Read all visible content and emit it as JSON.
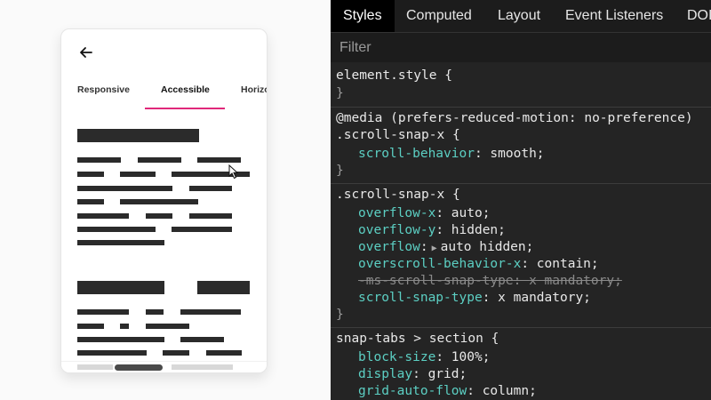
{
  "phone": {
    "tabs": [
      "Responsive",
      "Accessible",
      "Horizo"
    ],
    "active_tab": "Accessible",
    "accent_color": "#e0287a",
    "back_icon": "arrow-left-icon"
  },
  "devtools": {
    "tabs": [
      "Styles",
      "Computed",
      "Layout",
      "Event Listeners",
      "DOI"
    ],
    "active_tab": "Styles",
    "filter_placeholder": "Filter",
    "rules": {
      "element_style": {
        "selector": "element.style {",
        "close": "}"
      },
      "media_rule": {
        "media": "@media (prefers-reduced-motion: no-preference)",
        "selector": ".scroll-snap-x {",
        "decls": [
          {
            "prop": "scroll-behavior",
            "value": "smooth;"
          }
        ],
        "close": "}"
      },
      "snap_rule": {
        "selector": ".scroll-snap-x {",
        "decls": [
          {
            "prop": "overflow-x",
            "value": "auto;"
          },
          {
            "prop": "overflow-y",
            "value": "hidden;"
          },
          {
            "prop": "overflow",
            "value": "auto hidden;"
          },
          {
            "prop": "overscroll-behavior-x",
            "value": "contain;"
          },
          {
            "prop": "-ms-scroll-snap-type",
            "value": "x mandatory;"
          },
          {
            "prop": "scroll-snap-type",
            "value": "x mandatory;"
          }
        ],
        "close": "}"
      },
      "section_rule": {
        "selector": "snap-tabs > section {",
        "decls": [
          {
            "prop": "block-size",
            "value": "100%;"
          },
          {
            "prop": "display",
            "value": "grid;"
          },
          {
            "prop": "grid-auto-flow",
            "value": "column;"
          }
        ]
      }
    },
    "colors": {
      "property": "#5ccfc3",
      "background": "#242424"
    }
  }
}
